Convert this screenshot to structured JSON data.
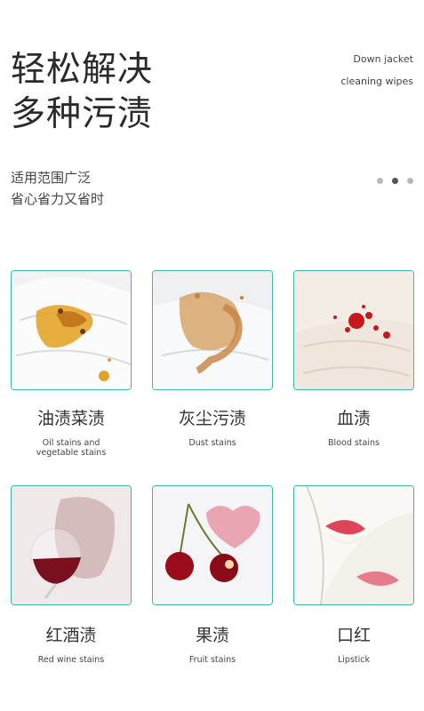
{
  "header": {
    "title_lines": [
      "轻松解决",
      "多种污渍"
    ],
    "product_en": [
      "Down jacket",
      "cleaning wipes"
    ],
    "subtitle_lines": [
      "适用范围广泛",
      "省心省力又省时"
    ],
    "carousel": {
      "total": 3,
      "active_index": 1
    }
  },
  "stains": [
    {
      "cn": "油渍菜渍",
      "en_lines": [
        "Oil stains and",
        "vegetable stains"
      ]
    },
    {
      "cn": "灰尘污渍",
      "en_lines": [
        "Dust stains"
      ]
    },
    {
      "cn": "血渍",
      "en_lines": [
        "Blood stains"
      ]
    },
    {
      "cn": "红酒渍",
      "en_lines": [
        "Red wine stains"
      ]
    },
    {
      "cn": "果渍",
      "en_lines": [
        "Fruit stains"
      ]
    },
    {
      "cn": "口红",
      "en_lines": [
        "Lipstick"
      ]
    }
  ],
  "colors": {
    "accent_border": "#3cb8b0",
    "dot_active": "#555555",
    "dot_inactive": "#b9b9b9"
  }
}
